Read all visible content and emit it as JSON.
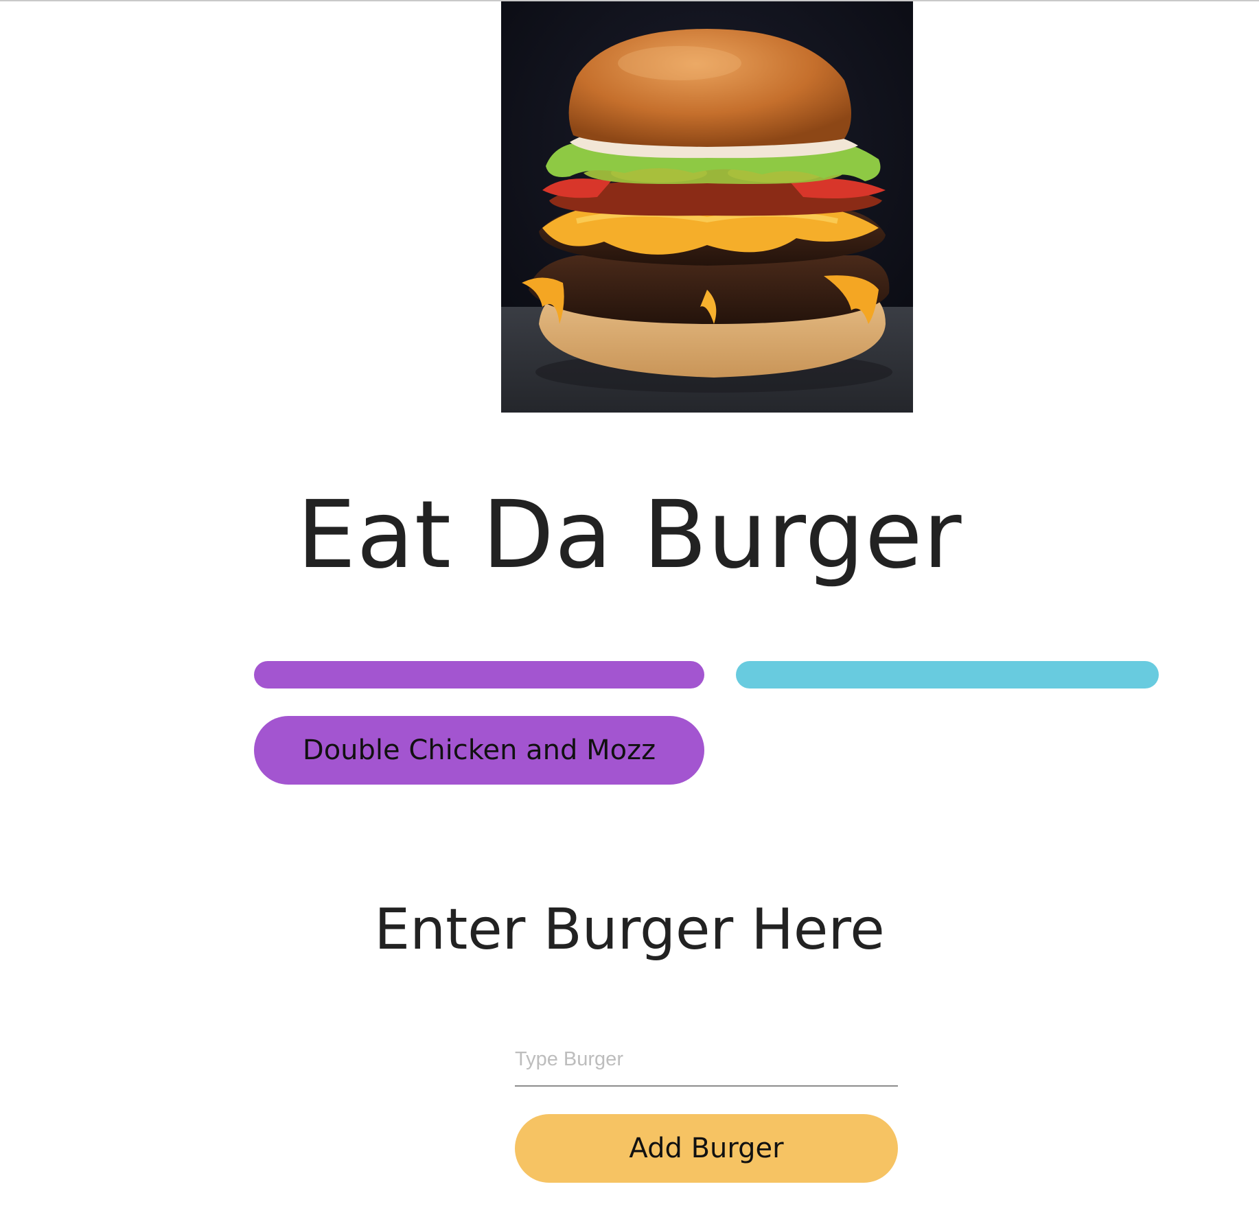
{
  "header": {
    "title": "Eat Da Burger"
  },
  "hero_image": {
    "name": "burger-photo"
  },
  "columns": {
    "uneaten_color": "#a355d0",
    "devoured_color": "#68cbdf"
  },
  "burgers": [
    {
      "name": "Double Chicken and Mozz"
    }
  ],
  "form": {
    "heading": "Enter Burger Here",
    "placeholder": "Type Burger",
    "value": "",
    "submit_label": "Add Burger",
    "submit_color": "#f6c363"
  }
}
